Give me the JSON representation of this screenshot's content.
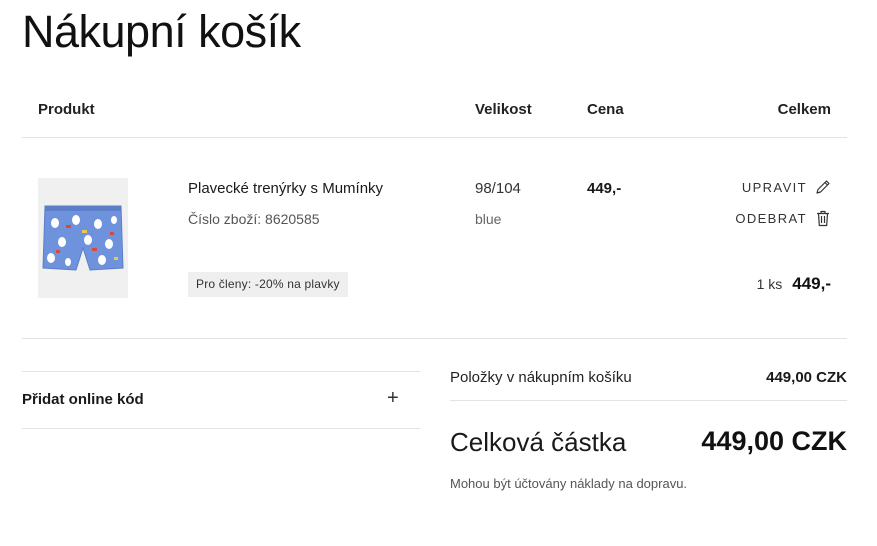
{
  "page": {
    "title": "Nákupní košík"
  },
  "table": {
    "headers": {
      "product": "Produkt",
      "size": "Velikost",
      "price": "Cena",
      "total": "Celkem"
    }
  },
  "item": {
    "name": "Plavecké trenýrky s Mumínky",
    "item_number": "Číslo zboží: 8620585",
    "promo": "Pro členy: -20% na plavky",
    "size": "98/104",
    "color": "blue",
    "price": "449,-",
    "edit_label": "UPRAVIT",
    "remove_label": "ODEBRAT",
    "quantity": "1 ks",
    "line_total": "449,-",
    "image_icon": "swim-trunks-image"
  },
  "promo_code": {
    "label": "Přidat online kód",
    "expand": "+"
  },
  "summary": {
    "items_label": "Položky v nákupním košíku",
    "items_value": "449,00 CZK",
    "total_label": "Celková částka",
    "total_value": "449,00 CZK",
    "shipping_note": "Mohou být účtovány náklady na dopravu."
  },
  "colors": {
    "text": "#1a1a1a",
    "divider": "#e3e3e3",
    "promo_bg": "#efefef",
    "product_blue": "#6f92dd"
  }
}
